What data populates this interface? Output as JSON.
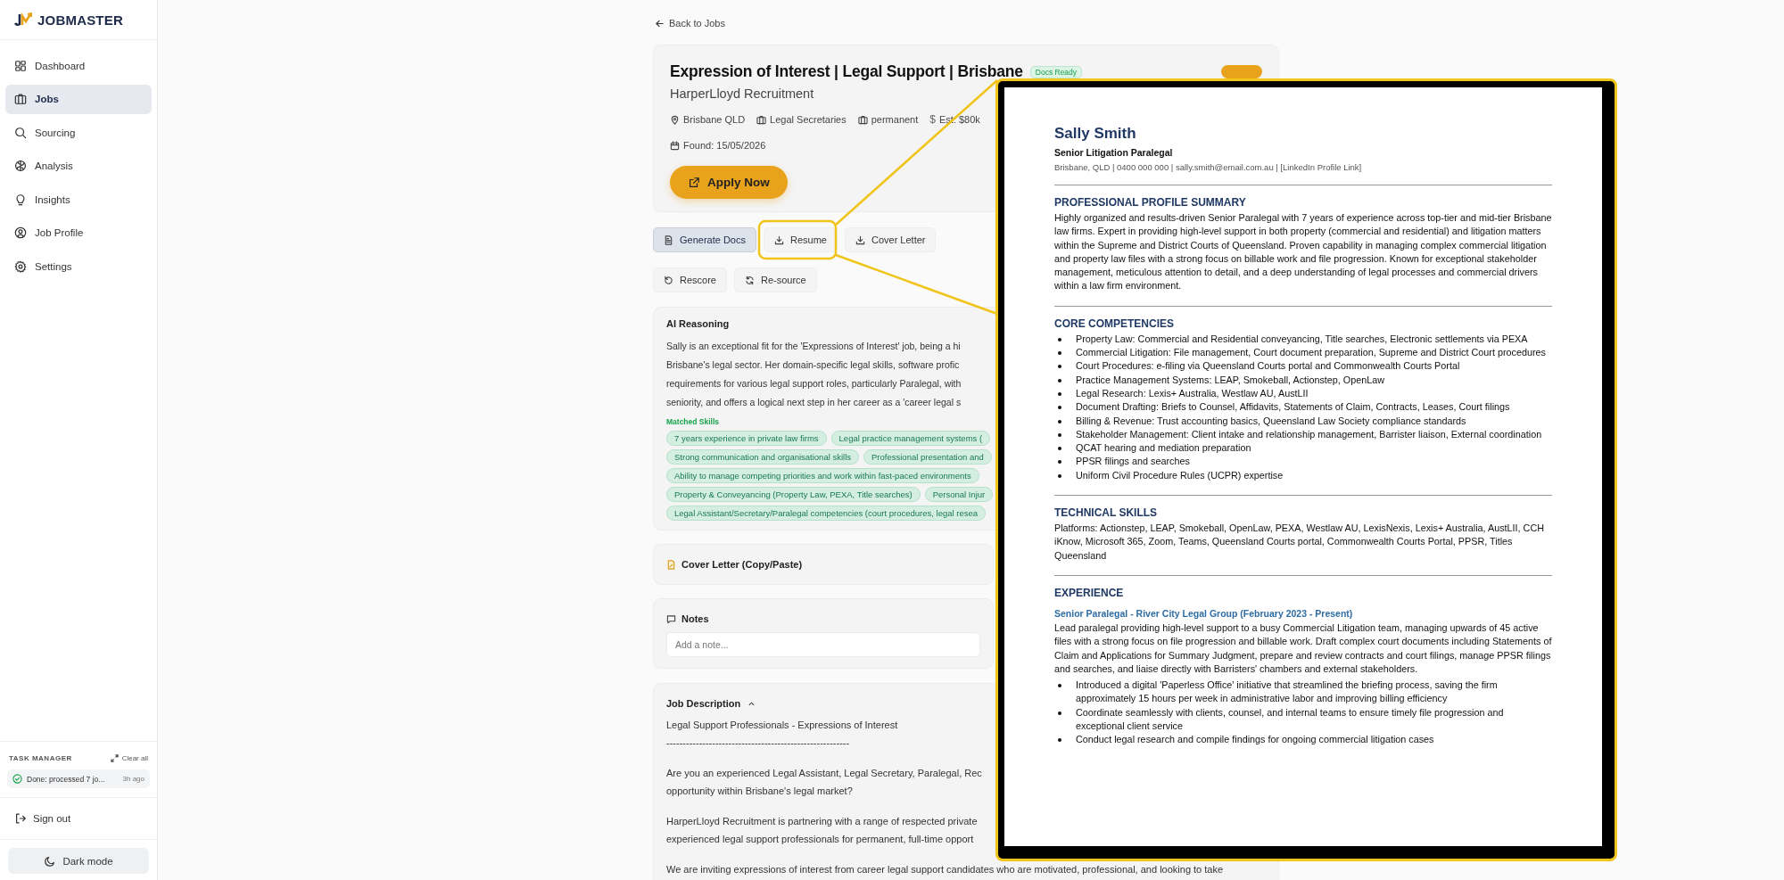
{
  "sidebar": {
    "brand": "JOBMASTER",
    "nav": [
      {
        "label": "Dashboard",
        "selected": false
      },
      {
        "label": "Jobs",
        "selected": true
      },
      {
        "label": "Sourcing",
        "selected": false
      },
      {
        "label": "Analysis",
        "selected": false
      },
      {
        "label": "Insights",
        "selected": false
      },
      {
        "label": "Job Profile",
        "selected": false
      },
      {
        "label": "Settings",
        "selected": false
      }
    ],
    "task_manager": {
      "title": "TASK MANAGER",
      "clear": "Clear all",
      "tasks": [
        {
          "text": "Done: processed 7 jo...",
          "time": "3h ago"
        }
      ]
    },
    "sign_out": "Sign out",
    "dark_mode": "Dark mode"
  },
  "back_link": "Back to Jobs",
  "job": {
    "title": "Expression of Interest | Legal Support | Brisbane",
    "status_badge": "Docs Ready",
    "company": "HarperLloyd Recruitment",
    "meta": [
      {
        "kind": "location",
        "text": "Brisbane QLD"
      },
      {
        "kind": "category",
        "text": "Legal Secretaries"
      },
      {
        "kind": "type",
        "text": "permanent"
      },
      {
        "kind": "salary",
        "icon": "$",
        "text": "Est: $80k"
      }
    ],
    "found": "Found: 15/05/2026",
    "apply": "Apply Now"
  },
  "actions": [
    {
      "label": "Generate Docs",
      "selected": true
    },
    {
      "label": "Resume",
      "selected": false
    },
    {
      "label": "Cover Letter",
      "selected": false
    }
  ],
  "actions_2": [
    {
      "label": "Rescore"
    },
    {
      "label": "Re-source"
    }
  ],
  "reasoning": {
    "title": "AI Reasoning",
    "lines": [
      "Sally is an exceptional fit for the 'Expressions of Interest' job, being a hi",
      "Brisbane's legal sector. Her domain-specific legal skills, software profic",
      "requirements for various legal support roles, particularly Paralegal, with",
      "seniority, and offers a logical next step in her career as a 'career legal s"
    ],
    "skills_title": "Matched Skills",
    "skill_rows": [
      [
        "7 years experience in private law firms",
        "Legal practice management systems ("
      ],
      [
        "Strong communication and organisational skills",
        "Professional presentation and"
      ],
      [
        "Ability to manage competing priorities and work within fast-paced environments"
      ],
      [
        "Property & Conveyancing (Property Law, PEXA, Title searches)",
        "Personal Injur"
      ],
      [
        "Legal Assistant/Secretary/Paralegal competencies (court procedures, legal resea"
      ]
    ]
  },
  "cover_letter": {
    "title": "Cover Letter (Copy/Paste)"
  },
  "notes": {
    "title": "Notes",
    "placeholder": "Add a note..."
  },
  "job_description": {
    "title": "Job Description",
    "expanded": true,
    "paragraphs": [
      [
        "Legal Support Professionals - Expressions of Interest",
        "--------------------------------------------------------"
      ],
      [
        "Are you an experienced Legal Assistant, Legal Secretary, Paralegal, Rec",
        "opportunity within Brisbane's legal market?"
      ],
      [
        "HarperLloyd Recruitment is partnering with a range of respected private",
        "experienced legal support professionals for permanent, full-time opport"
      ],
      [
        "We are inviting expressions of interest from career legal support candidates who are motivated, professional, and looking to take"
      ]
    ]
  },
  "resume": {
    "name": "Sally Smith",
    "headline": "Senior Litigation Paralegal",
    "contact": "Brisbane, QLD | 0400 000 000 | sally.smith@email.com.au | [LinkedIn Profile Link]",
    "sections": [
      {
        "kind": "paragraph",
        "heading": "PROFESSIONAL PROFILE SUMMARY",
        "text": "Highly organized and results-driven Senior Paralegal with 7 years of experience across top-tier and mid-tier Brisbane law firms. Expert in providing high-level support in both property (commercial and residential) and litigation matters within the Supreme and District Courts of Queensland. Proven capability in managing complex commercial litigation and property law files with a strong focus on billable work and file progression. Known for exceptional stakeholder management, meticulous attention to detail, and a deep understanding of legal processes and commercial drivers within a law firm environment."
      },
      {
        "kind": "bullets",
        "heading": "CORE COMPETENCIES",
        "items": [
          "Property Law: Commercial and Residential conveyancing, Title searches, Electronic settlements via PEXA",
          "Commercial Litigation: File management, Court document preparation, Supreme and District Court procedures",
          "Court Procedures: e-filing via Queensland Courts portal and Commonwealth Courts Portal",
          "Practice Management Systems: LEAP, Smokeball, Actionstep, OpenLaw",
          "Legal Research: Lexis+ Australia, Westlaw AU, AustLII",
          "Document Drafting: Briefs to Counsel, Affidavits, Statements of Claim, Contracts, Leases, Court filings",
          "Billing & Revenue: Trust accounting basics, Queensland Law Society compliance standards",
          "Stakeholder Management: Client intake and relationship management, Barrister liaison, External coordination",
          "QCAT hearing and mediation preparation",
          "PPSR filings and searches",
          "Uniform Civil Procedure Rules (UCPR) expertise"
        ]
      },
      {
        "kind": "paragraph",
        "heading": "TECHNICAL SKILLS",
        "text": "Platforms: Actionstep, LEAP, Smokeball, OpenLaw, PEXA, Westlaw AU, LexisNexis, Lexis+ Australia, AustLII, CCH iKnow, Microsoft 365, Zoom, Teams, Queensland Courts portal, Commonwealth Courts Portal, PPSR, Titles Queensland"
      },
      {
        "kind": "experience",
        "heading": "EXPERIENCE",
        "roles": [
          {
            "title": "Senior Paralegal - River City Legal Group (February 2023 - Present)",
            "summary": "Lead paralegal providing high-level support to a busy Commercial Litigation team, managing upwards of 45 active files with a strong focus on file progression and billable work. Draft complex court documents including Statements of Claim and Applications for Summary Judgment, prepare and review contracts and court filings, manage PPSR filings and searches, and liaise directly with Barristers' chambers and external stakeholders.",
            "bullets": [
              "Introduced a digital 'Paperless Office' initiative that streamlined the briefing process, saving the firm approximately 15 hours per week in administrative labor and improving billing efficiency",
              "Coordinate seamlessly with clients, counsel, and internal teams to ensure timely file progression and exceptional client service",
              "Conduct legal research and compile findings for ongoing commercial litigation cases"
            ]
          }
        ]
      }
    ]
  }
}
